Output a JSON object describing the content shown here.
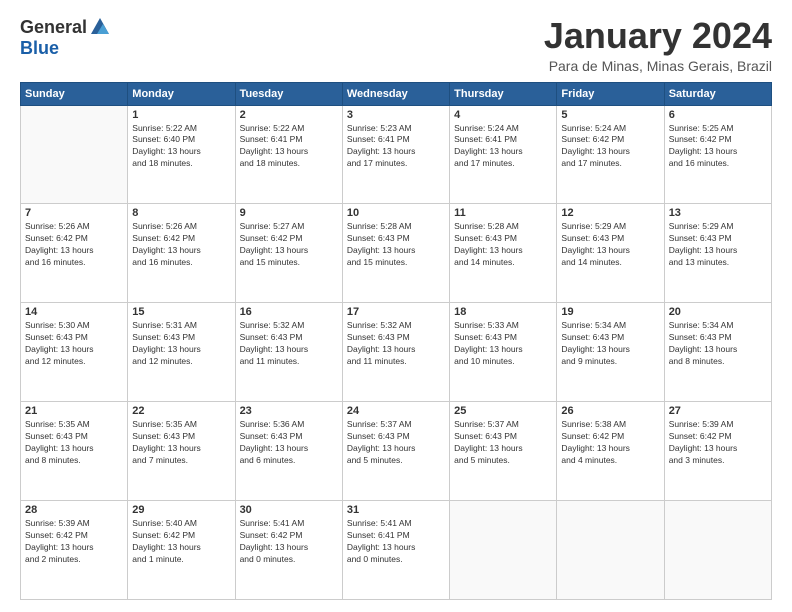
{
  "logo": {
    "general": "General",
    "blue": "Blue"
  },
  "title": "January 2024",
  "location": "Para de Minas, Minas Gerais, Brazil",
  "days_header": [
    "Sunday",
    "Monday",
    "Tuesday",
    "Wednesday",
    "Thursday",
    "Friday",
    "Saturday"
  ],
  "weeks": [
    [
      {
        "day": "",
        "info": ""
      },
      {
        "day": "1",
        "info": "Sunrise: 5:22 AM\nSunset: 6:40 PM\nDaylight: 13 hours\nand 18 minutes."
      },
      {
        "day": "2",
        "info": "Sunrise: 5:22 AM\nSunset: 6:41 PM\nDaylight: 13 hours\nand 18 minutes."
      },
      {
        "day": "3",
        "info": "Sunrise: 5:23 AM\nSunset: 6:41 PM\nDaylight: 13 hours\nand 17 minutes."
      },
      {
        "day": "4",
        "info": "Sunrise: 5:24 AM\nSunset: 6:41 PM\nDaylight: 13 hours\nand 17 minutes."
      },
      {
        "day": "5",
        "info": "Sunrise: 5:24 AM\nSunset: 6:42 PM\nDaylight: 13 hours\nand 17 minutes."
      },
      {
        "day": "6",
        "info": "Sunrise: 5:25 AM\nSunset: 6:42 PM\nDaylight: 13 hours\nand 16 minutes."
      }
    ],
    [
      {
        "day": "7",
        "info": "Sunrise: 5:26 AM\nSunset: 6:42 PM\nDaylight: 13 hours\nand 16 minutes."
      },
      {
        "day": "8",
        "info": "Sunrise: 5:26 AM\nSunset: 6:42 PM\nDaylight: 13 hours\nand 16 minutes."
      },
      {
        "day": "9",
        "info": "Sunrise: 5:27 AM\nSunset: 6:42 PM\nDaylight: 13 hours\nand 15 minutes."
      },
      {
        "day": "10",
        "info": "Sunrise: 5:28 AM\nSunset: 6:43 PM\nDaylight: 13 hours\nand 15 minutes."
      },
      {
        "day": "11",
        "info": "Sunrise: 5:28 AM\nSunset: 6:43 PM\nDaylight: 13 hours\nand 14 minutes."
      },
      {
        "day": "12",
        "info": "Sunrise: 5:29 AM\nSunset: 6:43 PM\nDaylight: 13 hours\nand 14 minutes."
      },
      {
        "day": "13",
        "info": "Sunrise: 5:29 AM\nSunset: 6:43 PM\nDaylight: 13 hours\nand 13 minutes."
      }
    ],
    [
      {
        "day": "14",
        "info": "Sunrise: 5:30 AM\nSunset: 6:43 PM\nDaylight: 13 hours\nand 12 minutes."
      },
      {
        "day": "15",
        "info": "Sunrise: 5:31 AM\nSunset: 6:43 PM\nDaylight: 13 hours\nand 12 minutes."
      },
      {
        "day": "16",
        "info": "Sunrise: 5:32 AM\nSunset: 6:43 PM\nDaylight: 13 hours\nand 11 minutes."
      },
      {
        "day": "17",
        "info": "Sunrise: 5:32 AM\nSunset: 6:43 PM\nDaylight: 13 hours\nand 11 minutes."
      },
      {
        "day": "18",
        "info": "Sunrise: 5:33 AM\nSunset: 6:43 PM\nDaylight: 13 hours\nand 10 minutes."
      },
      {
        "day": "19",
        "info": "Sunrise: 5:34 AM\nSunset: 6:43 PM\nDaylight: 13 hours\nand 9 minutes."
      },
      {
        "day": "20",
        "info": "Sunrise: 5:34 AM\nSunset: 6:43 PM\nDaylight: 13 hours\nand 8 minutes."
      }
    ],
    [
      {
        "day": "21",
        "info": "Sunrise: 5:35 AM\nSunset: 6:43 PM\nDaylight: 13 hours\nand 8 minutes."
      },
      {
        "day": "22",
        "info": "Sunrise: 5:35 AM\nSunset: 6:43 PM\nDaylight: 13 hours\nand 7 minutes."
      },
      {
        "day": "23",
        "info": "Sunrise: 5:36 AM\nSunset: 6:43 PM\nDaylight: 13 hours\nand 6 minutes."
      },
      {
        "day": "24",
        "info": "Sunrise: 5:37 AM\nSunset: 6:43 PM\nDaylight: 13 hours\nand 5 minutes."
      },
      {
        "day": "25",
        "info": "Sunrise: 5:37 AM\nSunset: 6:43 PM\nDaylight: 13 hours\nand 5 minutes."
      },
      {
        "day": "26",
        "info": "Sunrise: 5:38 AM\nSunset: 6:42 PM\nDaylight: 13 hours\nand 4 minutes."
      },
      {
        "day": "27",
        "info": "Sunrise: 5:39 AM\nSunset: 6:42 PM\nDaylight: 13 hours\nand 3 minutes."
      }
    ],
    [
      {
        "day": "28",
        "info": "Sunrise: 5:39 AM\nSunset: 6:42 PM\nDaylight: 13 hours\nand 2 minutes."
      },
      {
        "day": "29",
        "info": "Sunrise: 5:40 AM\nSunset: 6:42 PM\nDaylight: 13 hours\nand 1 minute."
      },
      {
        "day": "30",
        "info": "Sunrise: 5:41 AM\nSunset: 6:42 PM\nDaylight: 13 hours\nand 0 minutes."
      },
      {
        "day": "31",
        "info": "Sunrise: 5:41 AM\nSunset: 6:41 PM\nDaylight: 13 hours\nand 0 minutes."
      },
      {
        "day": "",
        "info": ""
      },
      {
        "day": "",
        "info": ""
      },
      {
        "day": "",
        "info": ""
      }
    ]
  ]
}
